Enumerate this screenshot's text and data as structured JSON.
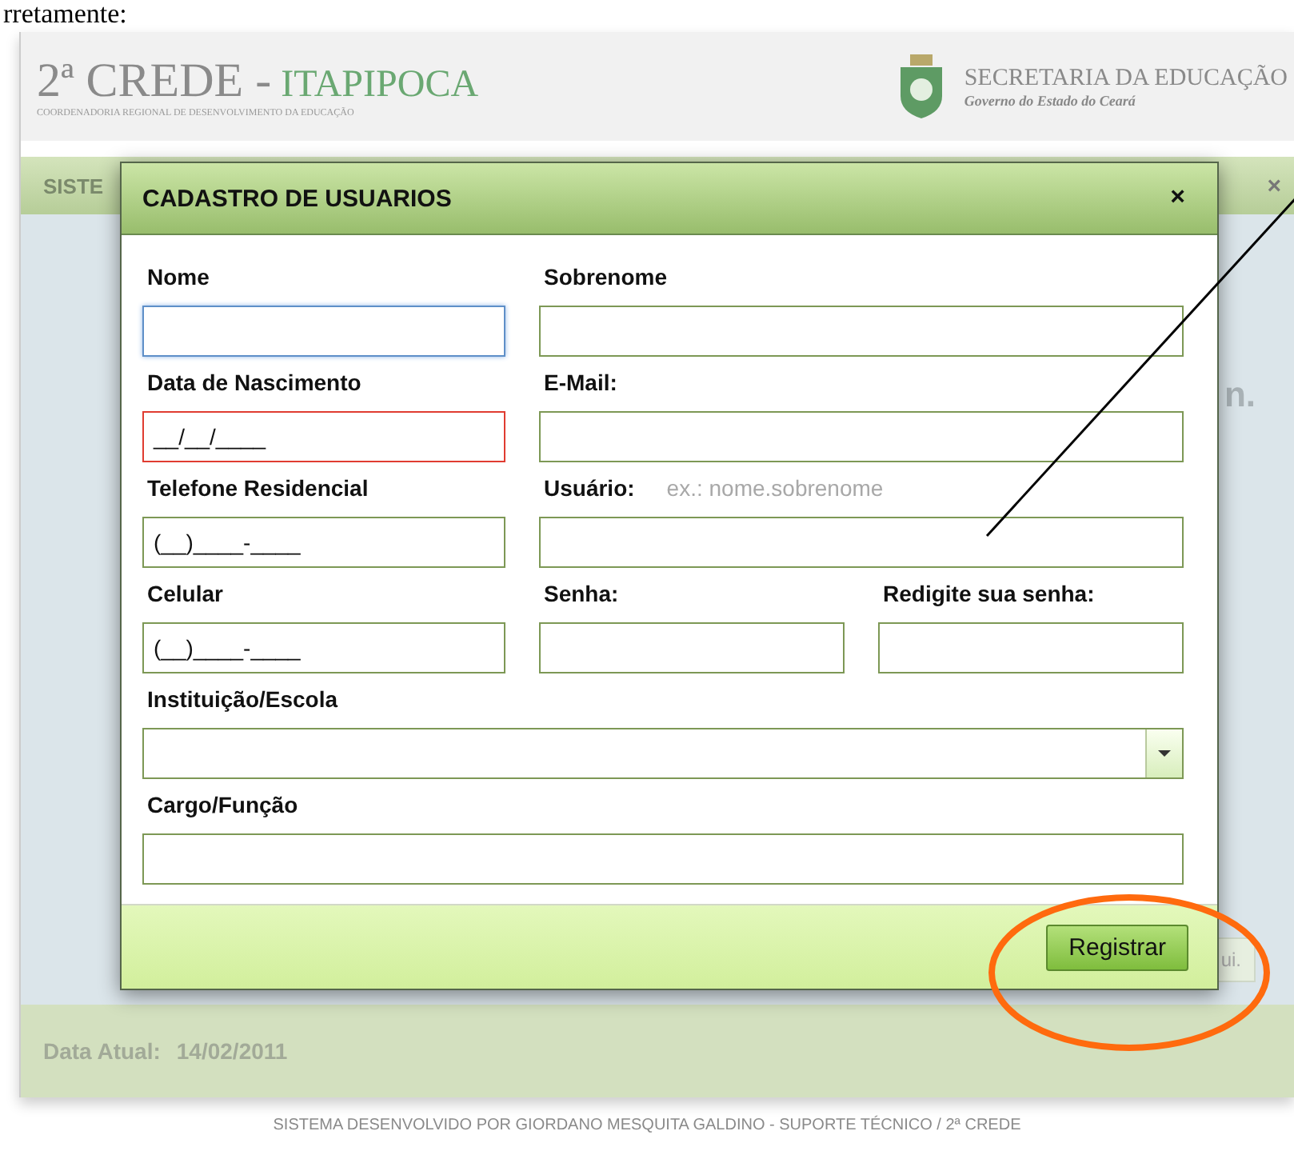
{
  "document_text": "rretamente:",
  "header": {
    "title_prefix": "2ª CREDE -",
    "title_city": "ITAPIPOCA",
    "subtitle": "COORDENADORIA REGIONAL DE DESENVOLVIMENTO DA EDUCAÇÃO",
    "secretaria": "SECRETARIA DA EDUCAÇÃO",
    "governo": "Governo do Estado do Ceará"
  },
  "background_panel": {
    "title": "SISTE",
    "close": "×",
    "partial_text": "n.",
    "partial_button": "ui."
  },
  "modal": {
    "title": "CADASTRO DE USUARIOS",
    "close": "×",
    "rows": [
      [
        {
          "label": "Nome",
          "kind": "text",
          "focused": true,
          "invalid": false
        },
        {
          "label": "Sobrenome",
          "kind": "text",
          "focused": false,
          "invalid": false
        }
      ],
      [
        {
          "label": "Data de Nascimento",
          "kind": "text",
          "value": "__/__/____",
          "focused": false,
          "invalid": true
        },
        {
          "label": "E-Mail:",
          "kind": "text",
          "focused": false,
          "invalid": false
        }
      ],
      [
        {
          "label": "Telefone Residencial",
          "kind": "text",
          "value": "(__)____-____",
          "focused": false,
          "invalid": false
        },
        {
          "label": "Usuário:",
          "hint": "ex.: nome.sobrenome",
          "kind": "text",
          "focused": false,
          "invalid": false
        }
      ],
      [
        {
          "label": "Celular",
          "kind": "text",
          "value": "(__)____-____",
          "focused": false,
          "invalid": false
        },
        {
          "label": "Senha:",
          "kind": "text",
          "focused": false,
          "invalid": false
        },
        {
          "label": "Redigite sua senha:",
          "kind": "text",
          "focused": false,
          "invalid": false
        }
      ],
      [
        {
          "label": "Instituição/Escola",
          "kind": "select",
          "focused": false,
          "invalid": false
        }
      ],
      [
        {
          "label": "Cargo/Função",
          "kind": "text",
          "focused": false,
          "invalid": false
        }
      ]
    ],
    "submit": "Registrar"
  },
  "footer": {
    "date_label": "Data Atual:",
    "date": "14/02/2011"
  },
  "credits": "SISTEMA DESENVOLVIDO POR GIORDANO MESQUITA GALDINO - SUPORTE TÉCNICO / 2ª CREDE"
}
